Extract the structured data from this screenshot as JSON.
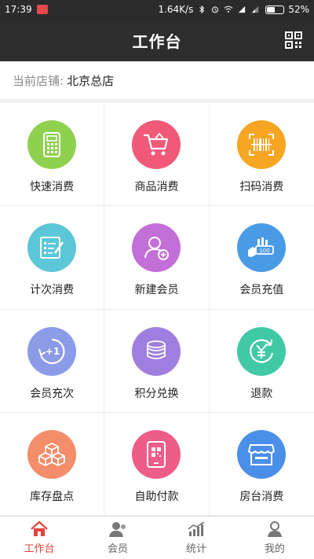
{
  "status": {
    "time": "17:39",
    "speed": "1.64K/s",
    "battery": "52%",
    "battery_fraction": 0.52
  },
  "header": {
    "title": "工作台"
  },
  "store": {
    "label": "当前店铺:",
    "name": "北京总店"
  },
  "grid": [
    {
      "label": "快速消费",
      "color": "#8fd14f",
      "icon": "calculator-icon"
    },
    {
      "label": "商品消费",
      "color": "#f05a78",
      "icon": "shopping-cart-icon"
    },
    {
      "label": "扫码消费",
      "color": "#f6a623",
      "icon": "barcode-scan-icon"
    },
    {
      "label": "计次消费",
      "color": "#5bc7d8",
      "icon": "checklist-icon"
    },
    {
      "label": "新建会员",
      "color": "#c36fd8",
      "icon": "add-user-icon"
    },
    {
      "label": "会员充值",
      "color": "#4a9be6",
      "icon": "card-recharge-icon"
    },
    {
      "label": "会员充次",
      "color": "#8b9be8",
      "icon": "plus-one-icon"
    },
    {
      "label": "积分兑换",
      "color": "#9e7fe0",
      "icon": "coins-icon"
    },
    {
      "label": "退款",
      "color": "#41c9a4",
      "icon": "refund-yuan-icon"
    },
    {
      "label": "库存盘点",
      "color": "#f38d6a",
      "icon": "boxes-icon"
    },
    {
      "label": "自助付款",
      "color": "#ee5c88",
      "icon": "phone-qr-icon"
    },
    {
      "label": "房台消费",
      "color": "#4a8fe8",
      "icon": "storefront-icon"
    }
  ],
  "tabs": [
    {
      "label": "工作台",
      "icon": "home-icon",
      "active": true
    },
    {
      "label": "会员",
      "icon": "member-icon",
      "active": false
    },
    {
      "label": "统计",
      "icon": "stats-icon",
      "active": false
    },
    {
      "label": "我的",
      "icon": "profile-icon",
      "active": false
    }
  ],
  "colors": {
    "accent": "#e0453c",
    "header_bg": "#2d2d2d"
  }
}
